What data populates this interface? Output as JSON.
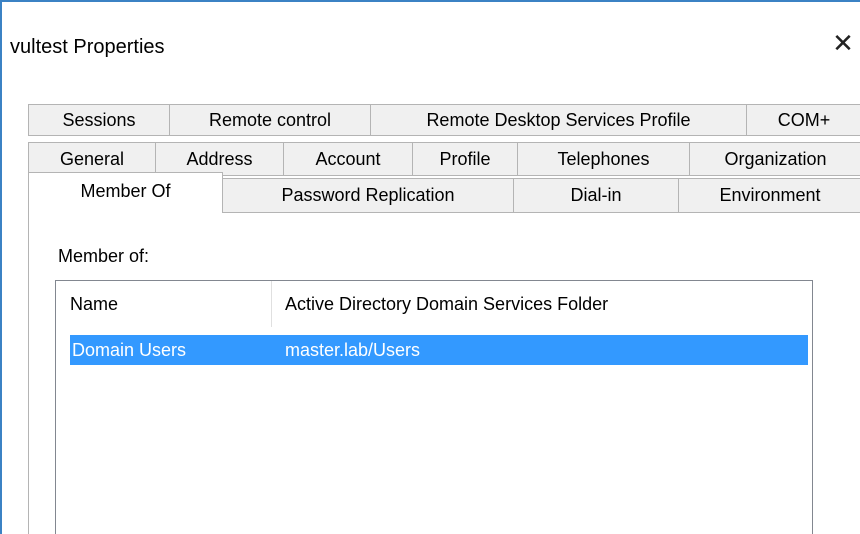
{
  "window": {
    "title": "vultest Properties",
    "close_glyph": "✕"
  },
  "tabs": {
    "row1": [
      "Sessions",
      "Remote control",
      "Remote Desktop Services Profile",
      "COM+"
    ],
    "row2": [
      "General",
      "Address",
      "Account",
      "Profile",
      "Telephones",
      "Organization"
    ],
    "row3": [
      "Member Of",
      "Password Replication",
      "Dial-in",
      "Environment"
    ],
    "active": "Member Of"
  },
  "panel": {
    "member_of_label": "Member of:",
    "columns": [
      "Name",
      "Active Directory Domain Services Folder"
    ],
    "rows": [
      {
        "name": "Domain Users",
        "folder": "master.lab/Users",
        "selected": true
      }
    ]
  },
  "colors": {
    "selection": "#3399ff",
    "window_border": "#3b82c4",
    "tab_bg": "#f0f0f0"
  }
}
